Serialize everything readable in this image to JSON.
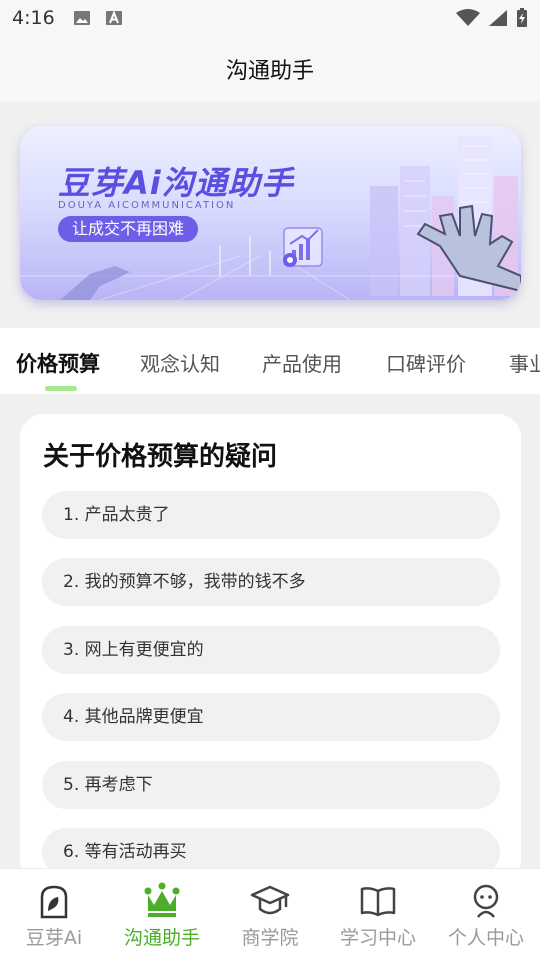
{
  "status_bar": {
    "time": "4:16"
  },
  "header": {
    "title": "沟通助手"
  },
  "banner": {
    "title": "豆芽Ai沟通助手",
    "subtitle": "DOUYA AICOMMUNICATION",
    "tagline": "让成交不再困难"
  },
  "tabs": [
    {
      "label": "价格预算",
      "active": true
    },
    {
      "label": "观念认知"
    },
    {
      "label": "产品使用"
    },
    {
      "label": "口碑评价"
    },
    {
      "label": "事业"
    }
  ],
  "section": {
    "title": "关于价格预算的疑问",
    "questions": [
      "1. 产品太贵了",
      "2. 我的预算不够，我带的钱不多",
      "3. 网上有更便宜的",
      "4. 其他品牌更便宜",
      "5. 再考虑下",
      "6. 等有活动再买"
    ]
  },
  "bottom_nav": [
    {
      "label": "豆芽Ai",
      "icon": "sprout-icon"
    },
    {
      "label": "沟通助手",
      "icon": "crown-icon",
      "active": true
    },
    {
      "label": "商学院",
      "icon": "graduation-cap-icon"
    },
    {
      "label": "学习中心",
      "icon": "book-icon"
    },
    {
      "label": "个人中心",
      "icon": "person-icon"
    }
  ],
  "colors": {
    "accent": "#4cae2a",
    "tab_indicator": "#a6e88c",
    "banner_primary": "#6d5ee8"
  }
}
